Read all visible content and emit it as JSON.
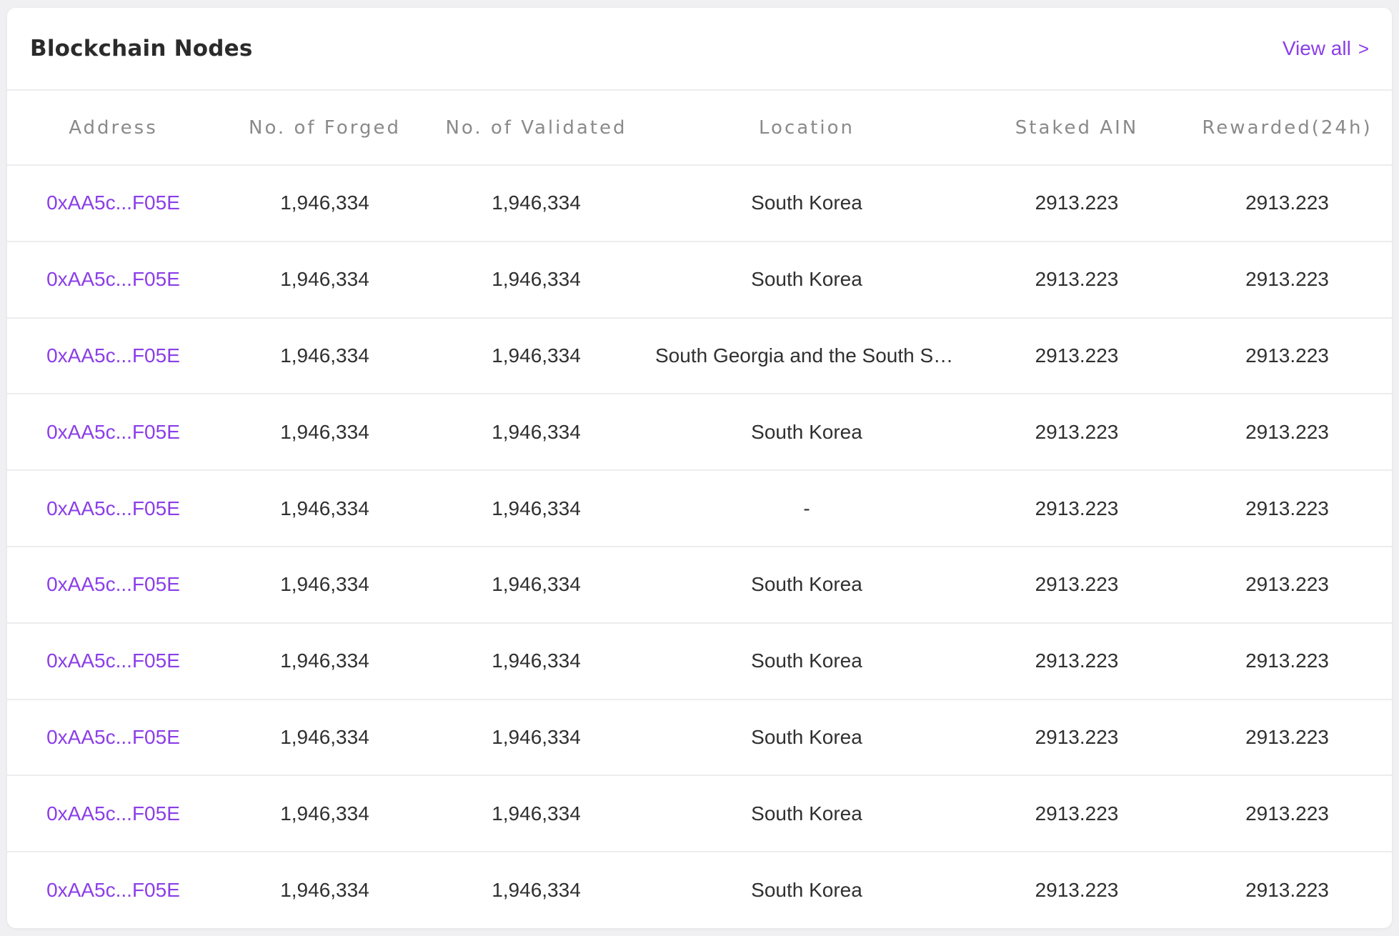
{
  "card": {
    "title": "Blockchain Nodes",
    "view_all_label": "View all",
    "view_all_chevron": ">"
  },
  "colors": {
    "accent": "#8b3ee8",
    "text": "#303030",
    "header_text": "#8a8a8a",
    "divider": "#ededf0",
    "background": "#f0f0f2"
  },
  "table": {
    "columns": [
      "Address",
      "No. of Forged",
      "No. of Validated",
      "Location",
      "Staked AIN",
      "Rewarded(24h)"
    ],
    "rows": [
      [
        "0xAA5c...F05E",
        "1,946,334",
        "1,946,334",
        "South Korea",
        "2913.223",
        "2913.223"
      ],
      [
        "0xAA5c...F05E",
        "1,946,334",
        "1,946,334",
        "South Korea",
        "2913.223",
        "2913.223"
      ],
      [
        "0xAA5c...F05E",
        "1,946,334",
        "1,946,334",
        "South Georgia and the South Sandwich Islands",
        "2913.223",
        "2913.223"
      ],
      [
        "0xAA5c...F05E",
        "1,946,334",
        "1,946,334",
        "South Korea",
        "2913.223",
        "2913.223"
      ],
      [
        "0xAA5c...F05E",
        "1,946,334",
        "1,946,334",
        "-",
        "2913.223",
        "2913.223"
      ],
      [
        "0xAA5c...F05E",
        "1,946,334",
        "1,946,334",
        "South Korea",
        "2913.223",
        "2913.223"
      ],
      [
        "0xAA5c...F05E",
        "1,946,334",
        "1,946,334",
        "South Korea",
        "2913.223",
        "2913.223"
      ],
      [
        "0xAA5c...F05E",
        "1,946,334",
        "1,946,334",
        "South Korea",
        "2913.223",
        "2913.223"
      ],
      [
        "0xAA5c...F05E",
        "1,946,334",
        "1,946,334",
        "South Korea",
        "2913.223",
        "2913.223"
      ],
      [
        "0xAA5c...F05E",
        "1,946,334",
        "1,946,334",
        "South Korea",
        "2913.223",
        "2913.223"
      ]
    ]
  }
}
